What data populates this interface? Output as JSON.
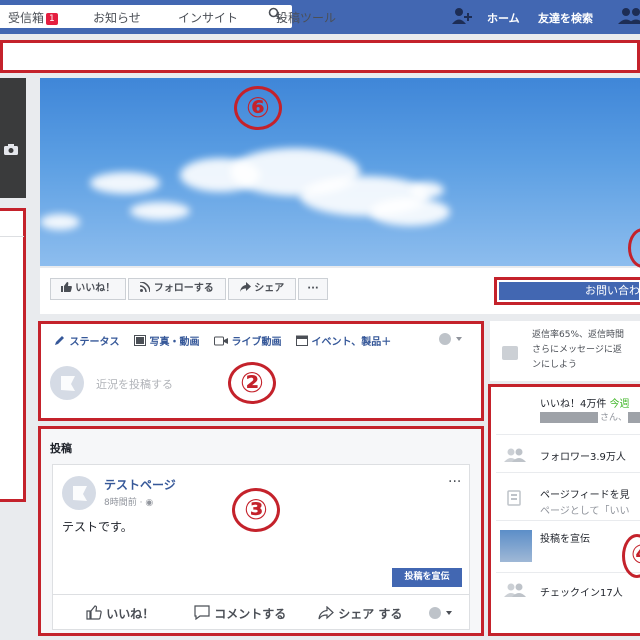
{
  "header": {
    "search_icon": "search-icon",
    "home": "ホーム",
    "find_friends": "友達を検索"
  },
  "tabs": {
    "inbox": "受信箱",
    "inbox_badge": "1",
    "notifications": "お知らせ",
    "insights": "インサイト",
    "publishing_tools": "投稿ツール"
  },
  "annotations": {
    "n6": "⑥",
    "n2": "②",
    "n3": "③",
    "n4": "④"
  },
  "action_bar": {
    "like": "いいね！",
    "follow": "フォローする",
    "share": "シェア",
    "more": "···",
    "contact": "お問い合わ"
  },
  "composer": {
    "status": "ステータス",
    "photo_video": "写真・動画",
    "live_video": "ライブ動画",
    "event": "イベント、製品＋",
    "placeholder": "近況を投稿する"
  },
  "posts": {
    "title": "投稿",
    "page_name": "テストページ",
    "time": "8時間前 · ",
    "text": "テストです。",
    "more": "···",
    "boost": "投稿を宣伝",
    "like": "いいね！",
    "comment": "コメントする",
    "share": "シェア する"
  },
  "right": {
    "response_line1": "返信率65%、返信時間",
    "response_line2": "さらにメッセージに返",
    "response_line3": "ンにしよう",
    "likes": "いいね！4万件",
    "likes_today": "今週",
    "likes_sub": "さん、",
    "followers": "フォロワー3.9万人",
    "feed_line1": "ページフィードを見",
    "feed_line2": "ページとして「いい",
    "promote": "投稿を宣伝",
    "checkins": "チェックイン17人"
  },
  "colors": {
    "fb_blue": "#4267b2",
    "link_blue": "#365899",
    "annotation_red": "#c4222b",
    "green": "#42b72a"
  }
}
